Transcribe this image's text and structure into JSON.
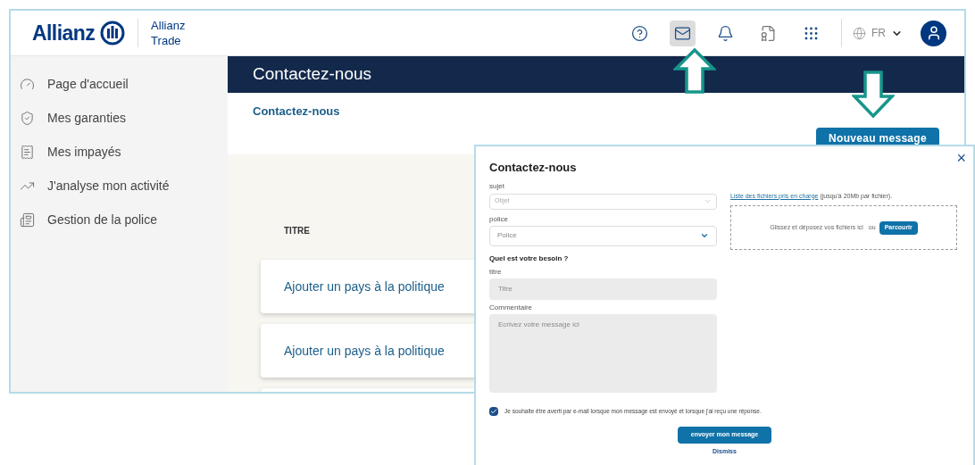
{
  "header": {
    "logo": "Allianz",
    "brand": [
      "Allianz",
      "Trade"
    ],
    "language": "FR",
    "toolbar": [
      {
        "kind": "help",
        "selected": false
      },
      {
        "kind": "mail",
        "selected": true
      },
      {
        "kind": "bell",
        "selected": false
      },
      {
        "kind": "document",
        "selected": false
      },
      {
        "kind": "apps",
        "selected": false
      }
    ]
  },
  "sidebar": {
    "items": [
      {
        "label": "Page d'accueil"
      },
      {
        "label": "Mes garanties"
      },
      {
        "label": "Mes impayés"
      },
      {
        "label": "J'analyse mon activité"
      },
      {
        "label": "Gestion de la police"
      }
    ]
  },
  "banner": {
    "title": "Contactez-nous"
  },
  "breadcrumb": "Contactez-nous",
  "new_message_button": "Nouveau message",
  "list": {
    "column": "TITRE",
    "rows": [
      "Ajouter un pays à la politique",
      "Ajouter un pays à la politique"
    ]
  },
  "dialog": {
    "title": "Contactez-nous",
    "close": "×",
    "subject": {
      "label": "sujet",
      "placeholder": "Objet"
    },
    "policy": {
      "label": "police",
      "placeholder": "Police"
    },
    "need_heading": "Quel est votre besoin ?",
    "title_field": {
      "label": "titre",
      "placeholder": "Titre"
    },
    "comment": {
      "label": "Commentaire",
      "placeholder": "Ecrivez votre message ici"
    },
    "files_link": "Liste des fichiers pris en charge",
    "files_note": "(jusqu'à 20Mb par fichier).",
    "dropzone": {
      "text": "Glissez et déposez vos fichiers ici",
      "or": "ou",
      "button": "Parcourir"
    },
    "notify": {
      "checked": true,
      "label": "Je souhaite être averti par e-mail lorsque mon message est envoyé et lorsque j'ai reçu une réponse."
    },
    "submit": "envoyer mon message",
    "dismiss": "Dismiss"
  }
}
